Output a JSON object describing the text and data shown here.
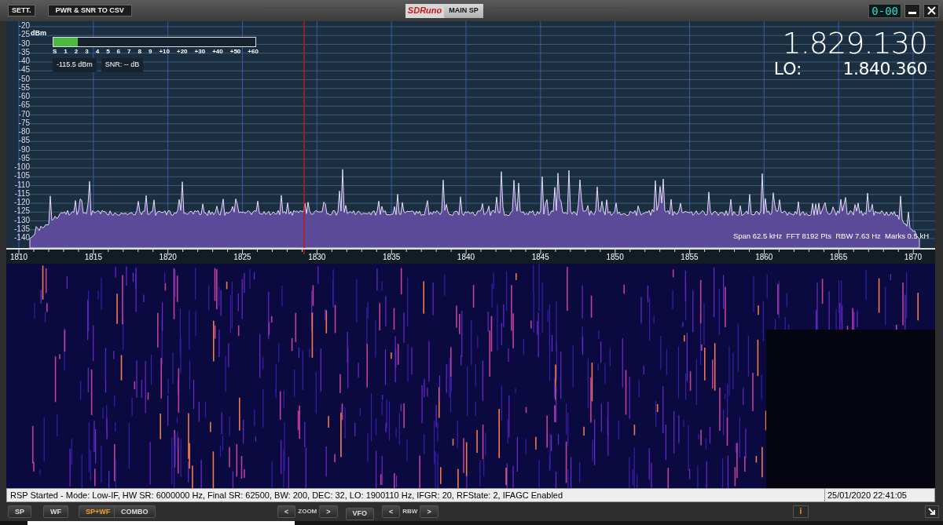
{
  "toolbar": {
    "buttons": [
      "SETT.",
      "PWR & SNR TO CSV"
    ]
  },
  "logo": "SDRuno",
  "panel_label": "MAIN SP",
  "counter": "0-00",
  "s_meter": {
    "unit": "dBm",
    "level": 0.12,
    "scale": [
      "S",
      "1",
      "2",
      "3",
      "4",
      "5",
      "6",
      "7",
      "8",
      "9",
      "+10",
      "+20",
      "+30",
      "+40",
      "+50",
      "+60"
    ],
    "power": "-115.5 dBm",
    "snr": "SNR: -- dB"
  },
  "frequency": {
    "main": "1.829.130",
    "lo_label": "LO:",
    "lo": "1.840.360"
  },
  "spectrum": {
    "y_ticks": [
      "-20",
      "-25",
      "-30",
      "-35",
      "-40",
      "-45",
      "-50",
      "-55",
      "-60",
      "-65",
      "-70",
      "-75",
      "-80",
      "-85",
      "-90",
      "-95",
      "-100",
      "-105",
      "-110",
      "-115",
      "-120",
      "-125",
      "-130",
      "-135",
      "-140"
    ],
    "x_ticks": [
      "1810",
      "1815",
      "1820",
      "1825",
      "1830",
      "1835",
      "1840",
      "1845",
      "1850",
      "1855",
      "1860",
      "1865",
      "1870"
    ],
    "info": "Span 62.5 kHz  FFT 8192 Pts  RBW 7.63 Hz  Marks 0.5 kH"
  },
  "status": {
    "message": "RSP Started - Mode: Low-IF, HW SR: 6000000 Hz, Final SR: 62500, BW: 200, DEC: 32, LO: 1900110 Hz, IFGR: 20, RFState: 2, IFAGC Enabled",
    "datetime": "25/01/2020 22:41:05"
  },
  "view_buttons": [
    {
      "label": "SP",
      "selected": false
    },
    {
      "label": "WF",
      "selected": false
    },
    {
      "label": "SP+WF",
      "selected": true
    },
    {
      "label": "COMBO",
      "selected": false
    }
  ],
  "zoom": {
    "prev": "<",
    "label": "ZOOM",
    "next": ">"
  },
  "vfo": "VFO",
  "rbw": {
    "prev": "<",
    "label": "RBW",
    "next": ">"
  },
  "info_button": "i"
}
